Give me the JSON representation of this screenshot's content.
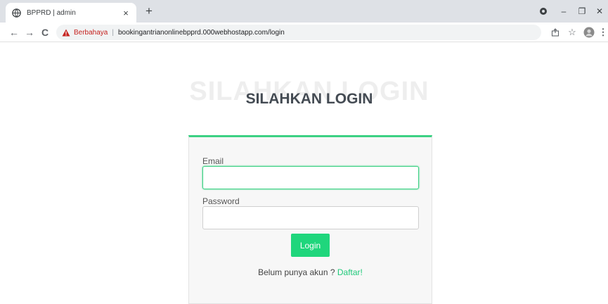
{
  "browser": {
    "tab_title": "BPPRD | admin",
    "tab_close": "×",
    "new_tab": "+",
    "window_controls": {
      "minimize": "–",
      "restore": "❐",
      "close": "✕"
    },
    "nav": {
      "back": "←",
      "forward": "→",
      "reload": "C"
    },
    "security_label": "Berbahaya",
    "separator": "|",
    "url": "bookingantrianonlinebpprd.000webhostapp.com/login",
    "toolbar_icons": [
      "share-icon",
      "star-icon",
      "profile-avatar",
      "menu-icon"
    ],
    "colors": {
      "danger": "#c5221f",
      "tab_bar": "#dee1e6"
    }
  },
  "page": {
    "ghost_title": "SILAHKAN LOGIN",
    "title": "SILAHKAN LOGIN",
    "form": {
      "email_label": "Email",
      "email_value": "",
      "password_label": "Password",
      "password_value": "",
      "login_button": "Login",
      "signup_prompt": "Belum punya akun ?",
      "signup_link": "Daftar!"
    },
    "colors": {
      "accent": "#1fd67c",
      "card_border": "#3dd184"
    }
  }
}
